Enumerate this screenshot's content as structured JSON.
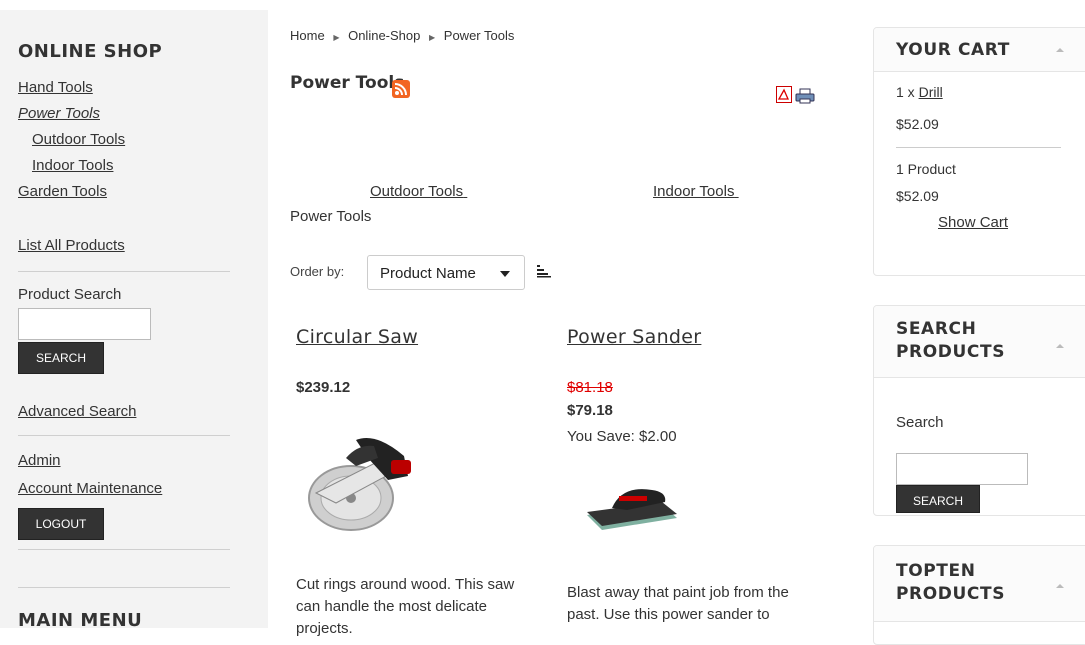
{
  "left": {
    "title": "ONLINE SHOP",
    "categories": [
      "Hand Tools",
      "Power Tools",
      "Outdoor Tools",
      "Indoor Tools",
      "Garden Tools"
    ],
    "list_all": "List All Products",
    "search_label": "Product Search",
    "search_button": "SEARCH",
    "advanced_search": "Advanced Search",
    "admin": "Admin",
    "account": "Account Maintenance",
    "logout": "LOGOUT",
    "main_menu": "MAIN MENU"
  },
  "breadcrumb": [
    "Home",
    "Online-Shop",
    "Power Tools"
  ],
  "page_title": "Power Tools",
  "subcategories": [
    "Outdoor Tools",
    "Indoor Tools"
  ],
  "category_desc": "Power Tools",
  "order_by": {
    "label": "Order by:",
    "selected": "Product Name"
  },
  "products": [
    {
      "name": "Circular Saw",
      "price": "$239.12",
      "description_1": "Cut rings around wood. This saw",
      "description_2": "can handle the most delicate",
      "description_3": "projects."
    },
    {
      "name": "Power Sander",
      "old_price": "$81.18",
      "price": "$79.18",
      "savings": "You Save: $2.00",
      "description_1": "Blast away that paint job from the",
      "description_2": "past. Use this power sander to"
    }
  ],
  "cart": {
    "title": "YOUR CART",
    "item_qty": "1 x ",
    "item_name": "Drill",
    "item_price": "$52.09",
    "count": "1 Product",
    "total": "$52.09",
    "show": "Show Cart"
  },
  "search_module": {
    "title_1": "SEARCH",
    "title_2": "PRODUCTS",
    "label": "Search",
    "button": "SEARCH"
  },
  "topten": {
    "title_1": "TOPTEN",
    "title_2": "PRODUCTS"
  },
  "colors": {
    "rss": "#f26522",
    "strike": "#e00000",
    "dark_button": "#333333"
  }
}
